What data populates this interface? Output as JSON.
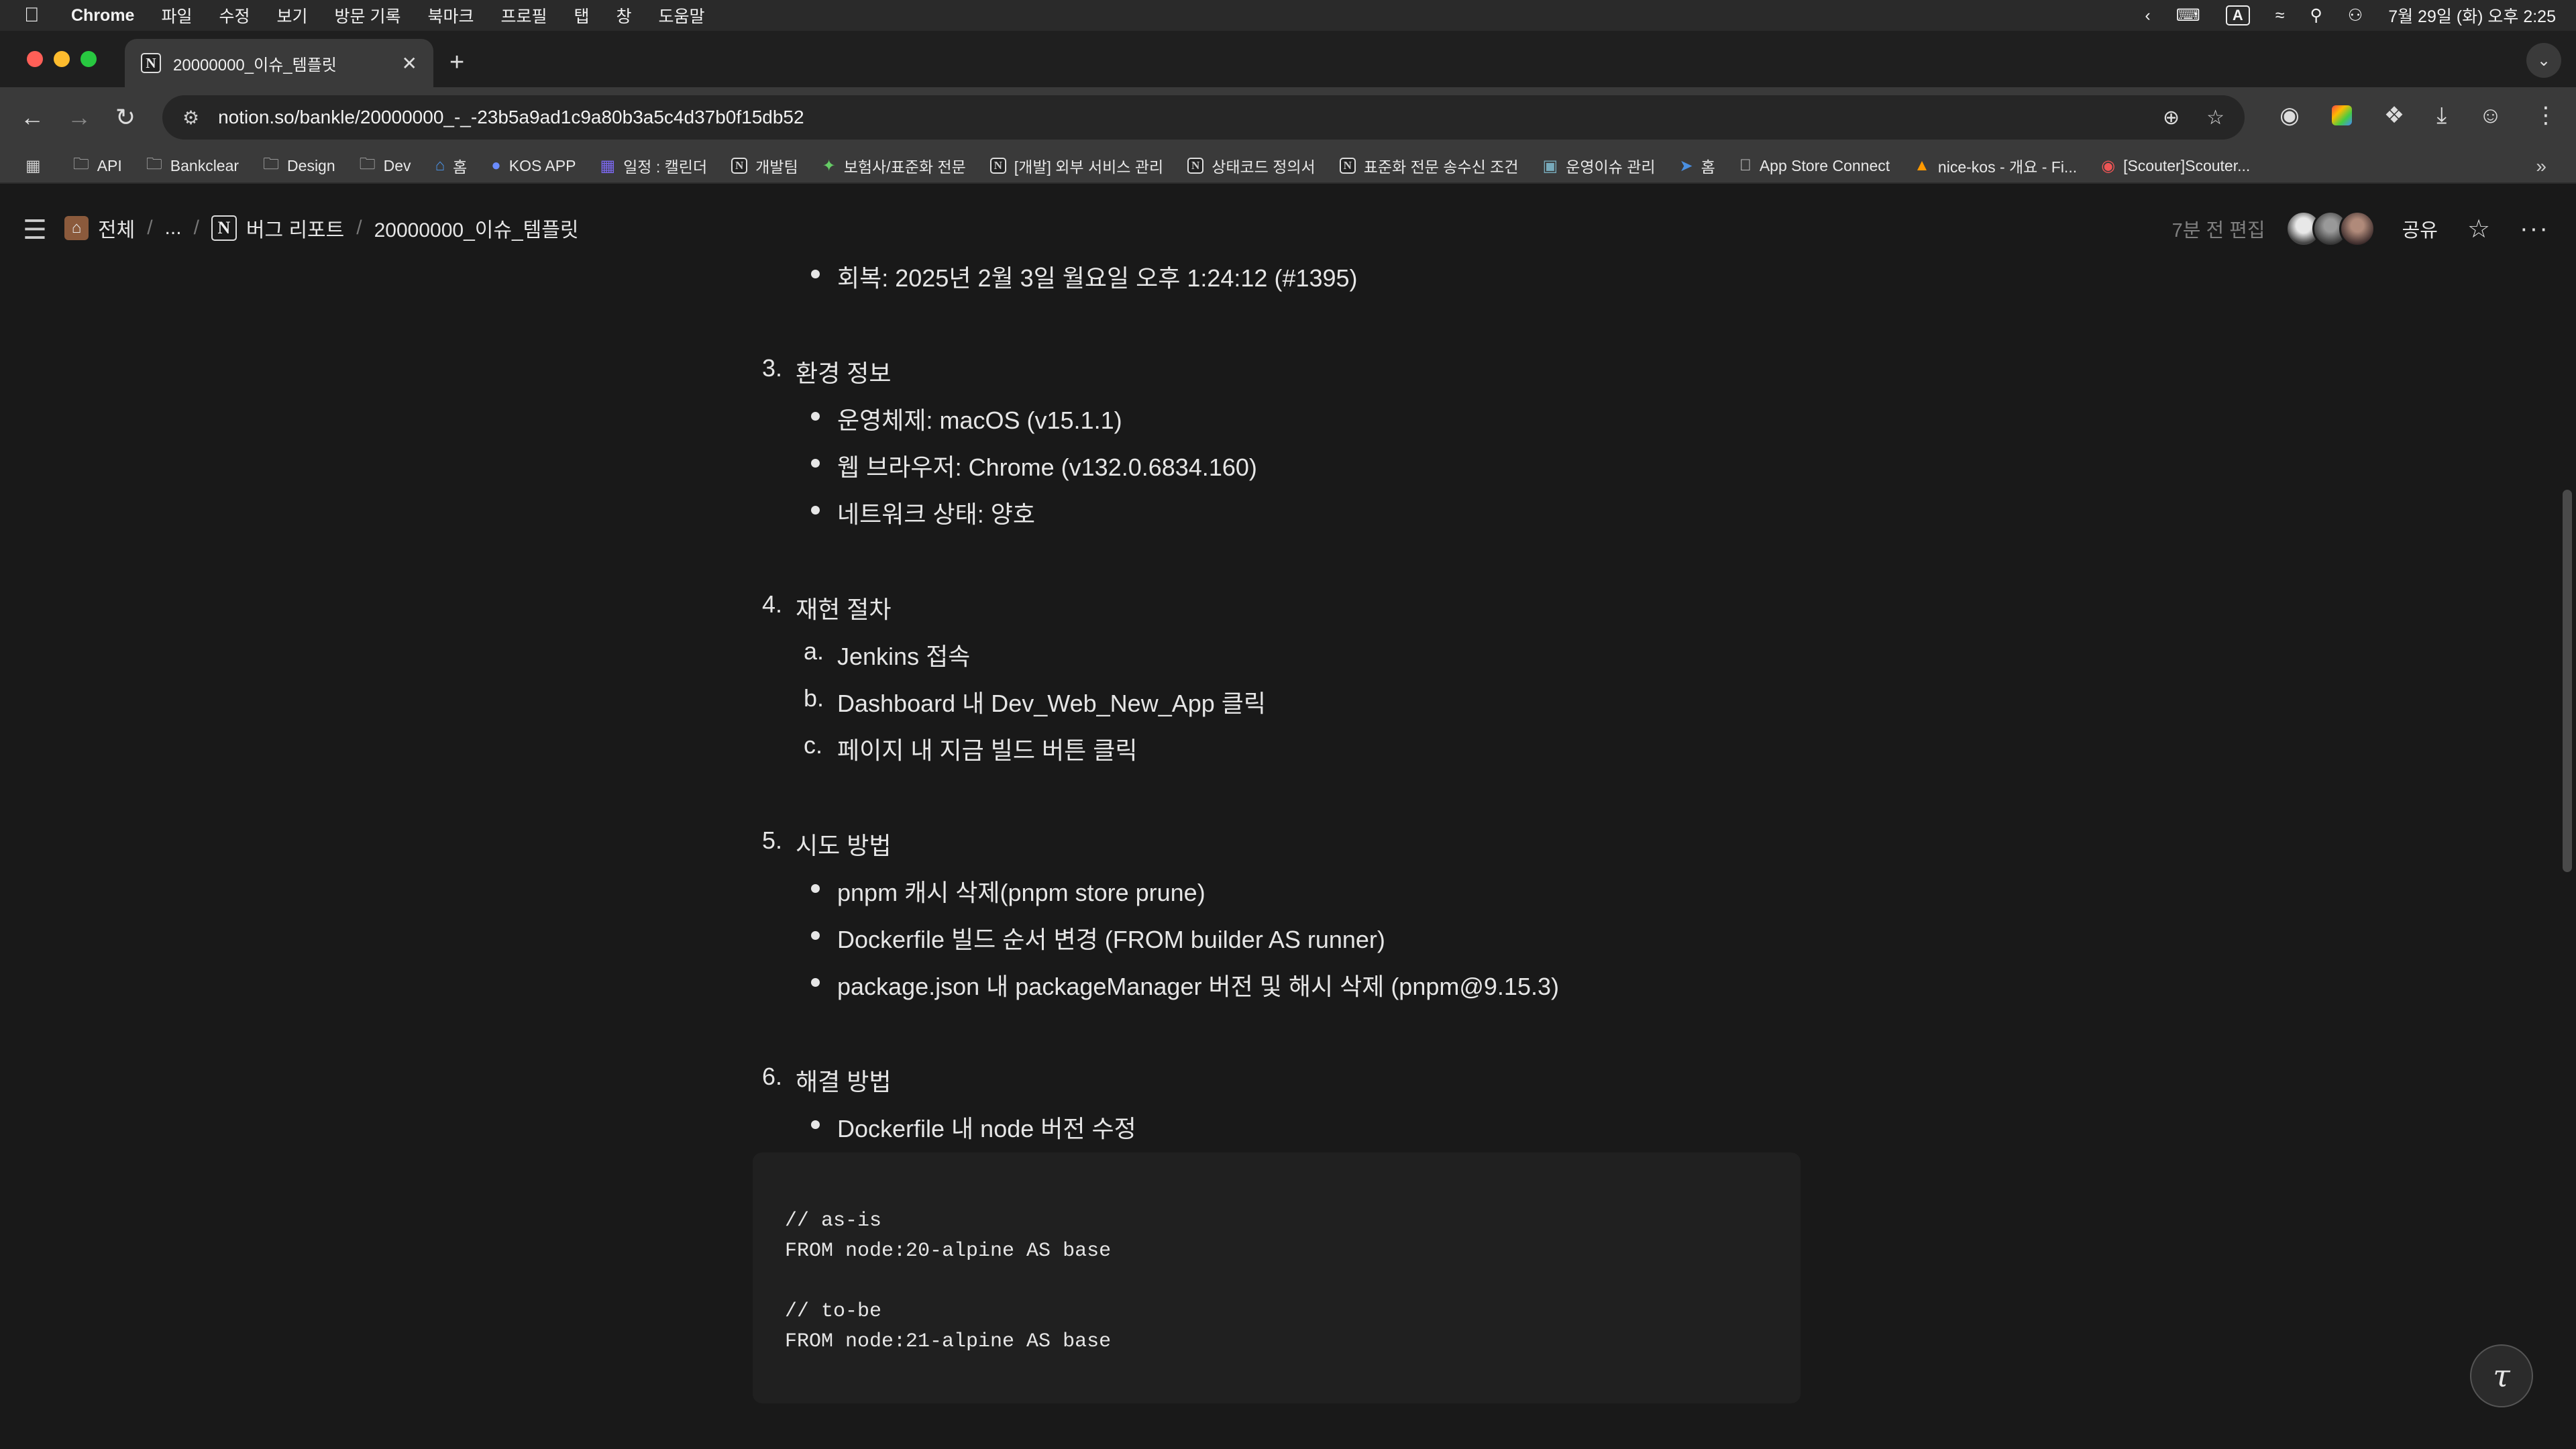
{
  "menubar": {
    "app": "Chrome",
    "items": [
      "파일",
      "수정",
      "보기",
      "방문 기록",
      "북마크",
      "프로필",
      "탭",
      "창",
      "도움말"
    ],
    "ime": "A",
    "datetime": "7월 29일 (화) 오후 2:25"
  },
  "browser": {
    "tab_title": "20000000_이슈_템플릿",
    "url": "notion.so/bankle/20000000_-_-23b5a9ad1c9a80b3a5c4d37b0f15db52"
  },
  "bookmarks": [
    {
      "label": "API",
      "icon": "folder-icon"
    },
    {
      "label": "Bankclear",
      "icon": "folder-icon"
    },
    {
      "label": "Design",
      "icon": "folder-icon"
    },
    {
      "label": "Dev",
      "icon": "folder-icon"
    },
    {
      "label": "홈",
      "icon": "home-icon"
    },
    {
      "label": "KOS APP",
      "icon": "app-icon"
    },
    {
      "label": "일정 : 캘린더",
      "icon": "calendar-icon"
    },
    {
      "label": "개발팀",
      "icon": "notion-icon"
    },
    {
      "label": "보험사/표준화 전문",
      "icon": "puzzle-icon"
    },
    {
      "label": "[개발] 외부 서비스 관리",
      "icon": "notion-icon"
    },
    {
      "label": "상태코드 정의서",
      "icon": "notion-icon"
    },
    {
      "label": "표준화 전문 송수신 조건",
      "icon": "notion-icon"
    },
    {
      "label": "운영이슈 관리",
      "icon": "image-icon"
    },
    {
      "label": "홈",
      "icon": "arrow-icon"
    },
    {
      "label": "App Store Connect",
      "icon": "apple-icon"
    },
    {
      "label": "nice-kos - 개요 - Fi...",
      "icon": "flame-icon"
    },
    {
      "label": "[Scouter]Scouter...",
      "icon": "scouter-icon"
    }
  ],
  "notion": {
    "breadcrumb": [
      "전체",
      "...",
      "버그 리포트",
      "20000000_이슈_템플릿"
    ],
    "edited": "7분 전 편집",
    "share": "공유"
  },
  "content": {
    "recovery": "회복: 2025년 2월 3일 월요일 오후 1:24:12 (#1395)",
    "sections": [
      {
        "num": "3.",
        "title": "환경 정보",
        "items": [
          "운영체제: macOS (v15.1.1)",
          "웹 브라우저: Chrome (v132.0.6834.160)",
          "네트워크 상태: 양호"
        ]
      },
      {
        "num": "4.",
        "title": "재현 절차",
        "items": [
          "Jenkins 접속",
          "Dashboard 내 Dev_Web_New_App 클릭",
          "페이지 내 지금 빌드 버튼 클릭"
        ],
        "markers": [
          "a.",
          "b.",
          "c."
        ]
      },
      {
        "num": "5.",
        "title": "시도 방법",
        "items": [
          "pnpm 캐시 삭제(pnpm store prune)",
          "Dockerfile 빌드 순서 변경 (FROM builder AS runner)",
          "package.json 내 packageManager 버전 및 해시 삭제 (pnpm@9.15.3)"
        ]
      },
      {
        "num": "6.",
        "title": "해결 방법",
        "items": [
          "Dockerfile 내 node 버전 수정"
        ]
      }
    ],
    "code": "// as-is\nFROM node:20-alpine AS base\n\n// to-be\nFROM node:21-alpine AS base"
  }
}
